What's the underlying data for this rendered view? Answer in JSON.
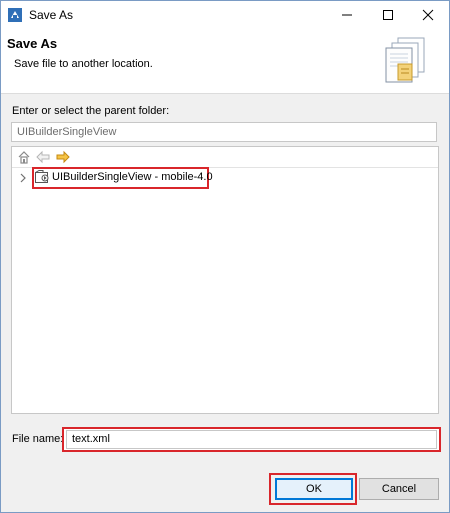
{
  "window": {
    "title": "Save As"
  },
  "header": {
    "title": "Save As",
    "subtitle": "Save file to another location."
  },
  "folder": {
    "label": "Enter or select the parent folder:",
    "value": "UIBuilderSingleView"
  },
  "tree": {
    "toolbar_icons": [
      "home-icon",
      "back-arrow-icon",
      "forward-arrow-icon"
    ],
    "items": [
      {
        "label": "UIBuilderSingleView - mobile-4.0",
        "icon": "project-icon",
        "expanded": false
      }
    ]
  },
  "file": {
    "label": "File name:",
    "value": "text.xml"
  },
  "buttons": {
    "ok": "OK",
    "cancel": "Cancel"
  },
  "colors": {
    "highlight": "#d9262b",
    "default_button_border": "#0078d7",
    "forward_arrow": "#e8a317"
  }
}
